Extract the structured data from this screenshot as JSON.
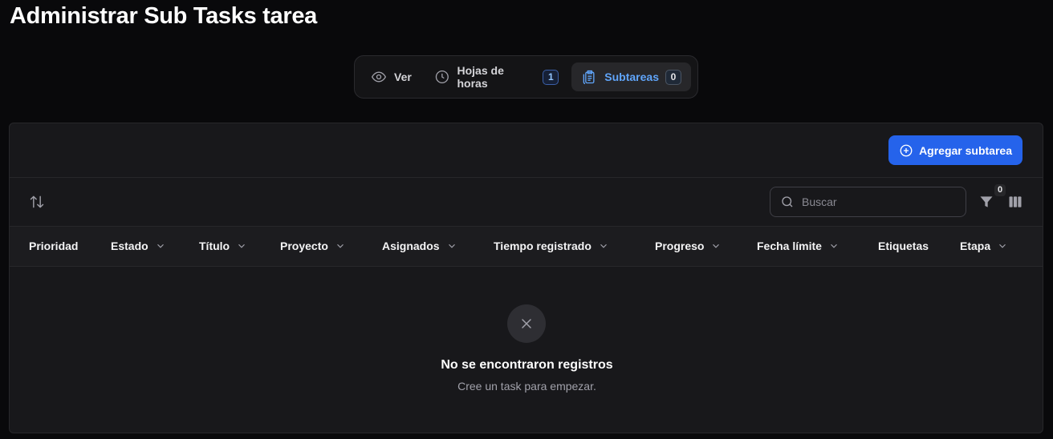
{
  "page": {
    "title": "Administrar Sub Tasks tarea"
  },
  "tabs": [
    {
      "label": "Ver",
      "icon": "eye-icon"
    },
    {
      "label": "Hojas de horas",
      "icon": "clock-icon",
      "badge": "1"
    },
    {
      "label": "Subtareas",
      "icon": "clipboard-icon",
      "badge": "0",
      "active": true
    }
  ],
  "header": {
    "add_button_label": "Agregar subtarea",
    "accent": "#2563eb"
  },
  "toolbar": {
    "search_placeholder": "Buscar",
    "filter_count": "0"
  },
  "table": {
    "columns": [
      {
        "label": "Prioridad",
        "sortable": false
      },
      {
        "label": "Estado",
        "sortable": true
      },
      {
        "label": "Título",
        "sortable": true
      },
      {
        "label": "Proyecto",
        "sortable": true
      },
      {
        "label": "Asignados",
        "sortable": true
      },
      {
        "label": "Tiempo registrado",
        "sortable": true
      },
      {
        "label": "Progreso",
        "sortable": true
      },
      {
        "label": "Fecha límite",
        "sortable": true
      },
      {
        "label": "Etiquetas",
        "sortable": false
      },
      {
        "label": "Etapa",
        "sortable": true
      }
    ]
  },
  "empty": {
    "title": "No se encontraron registros",
    "subtitle": "Cree un task para empezar."
  }
}
